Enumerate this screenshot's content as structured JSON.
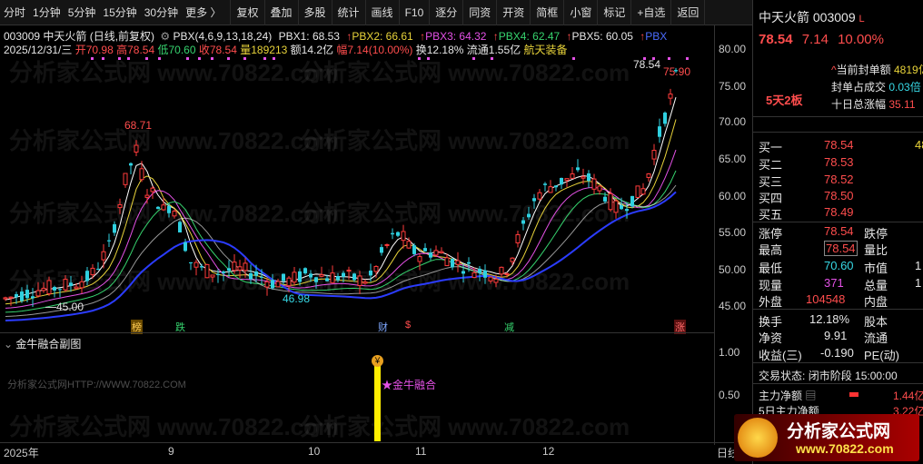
{
  "toolbar": {
    "items": [
      "分时",
      "1分钟",
      "5分钟",
      "15分钟",
      "30分钟",
      "更多",
      "复权",
      "叠加",
      "多股",
      "统计",
      "画线",
      "F10",
      "逐分",
      "同资",
      "开资",
      "简框",
      "小窗",
      "标记",
      "+自选",
      "返回"
    ],
    "more_glyph": "〉"
  },
  "header": {
    "line1_name": "003009 中天火箭 (日线,前复权)",
    "line1_ind": "PBX(4,6,9,13,18,24)",
    "pbx1": "PBX1: 68.53",
    "pbx2": "PBX2: 66.61",
    "pbx3": "PBX3: 64.32",
    "pbx4": "PBX4: 62.47",
    "pbx5": "PBX5: 60.05",
    "pbx6": "PBX",
    "line2_date": "2025/12/31/三",
    "open": "开70.98",
    "high": "高78.54",
    "low": "低70.60",
    "close": "收78.54",
    "vol": "量189213",
    "amt": "额14.2亿",
    "amp": "幅7.14(10.00%)",
    "turn": "换12.18%",
    "float": "流通1.55亿",
    "sector": "航天装备"
  },
  "chart_labels": {
    "high_label": "68.71",
    "low_label": "46.98",
    "start_label": "45.00",
    "last_label_a": "78.54",
    "last_label_b": "75.90",
    "markers": [
      "榜",
      "跌",
      "财",
      "$",
      "减",
      "涨"
    ]
  },
  "yaxis": [
    "80.00",
    "75.00",
    "70.00",
    "65.00",
    "60.00",
    "55.00",
    "50.00",
    "45.00"
  ],
  "sub": {
    "title": "金牛融合副图",
    "signal": "★金牛融合",
    "url": "分析家公式网HTTP://WWW.70822.COM",
    "yaxis": [
      "1.00",
      "0.50"
    ]
  },
  "xaxis": [
    "2025年",
    "9",
    "10",
    "11",
    "12"
  ],
  "xaxis_right": "日线",
  "watermark": "分析家公式网 www.70822.com",
  "panel": {
    "title": "中天火箭 003009",
    "flag": "L",
    "price": "78.54",
    "change": "7.14",
    "pct": "10.00%",
    "tag": "5天2板",
    "seal_amt_label": "当前封单额",
    "seal_amt_val": "4819亿",
    "seal_ratio_label": "封单占成交",
    "seal_ratio_val": "0.03倍",
    "ten_day_label": "十日总涨幅",
    "ten_day_val": "35.11",
    "bids": [
      {
        "label": "买一",
        "price": "78.54",
        "vol": "48"
      },
      {
        "label": "买二",
        "price": "78.53",
        "vol": ""
      },
      {
        "label": "买三",
        "price": "78.52",
        "vol": ""
      },
      {
        "label": "买四",
        "price": "78.50",
        "vol": ""
      },
      {
        "label": "买五",
        "price": "78.49",
        "vol": ""
      }
    ],
    "zt_label": "涨停",
    "zt_val": "78.54",
    "dt_label": "跌停",
    "hi_label": "最高",
    "hi_val": "78.54",
    "lb_label": "量比",
    "lo_label": "最低",
    "lo_val": "70.60",
    "sz_label": "市值",
    "sz_val": "1",
    "xl_label": "现量",
    "xl_val": "371",
    "zl_label": "总量",
    "zl_val": "1",
    "wp_label": "外盘",
    "wp_val": "104548",
    "np_label": "内盘",
    "hs_label": "换手",
    "hs_val": "12.18%",
    "gb_label": "股本",
    "jz_label": "净资",
    "jz_val": "9.91",
    "lt_label": "流通",
    "sy_label": "收益(",
    "sy_val": "-0.190",
    "pe_label": "PE(动)",
    "status_label": "交易状态:",
    "status_val": "闭市阶段 15:00:00",
    "zljz_label": "主力净额",
    "zljz_val": "1.44亿",
    "zljz5_label": "5日主力净额",
    "zljz5_val": "3.22亿"
  },
  "logo": {
    "name": "分析家公式网",
    "url": "www.70822.com"
  }
}
